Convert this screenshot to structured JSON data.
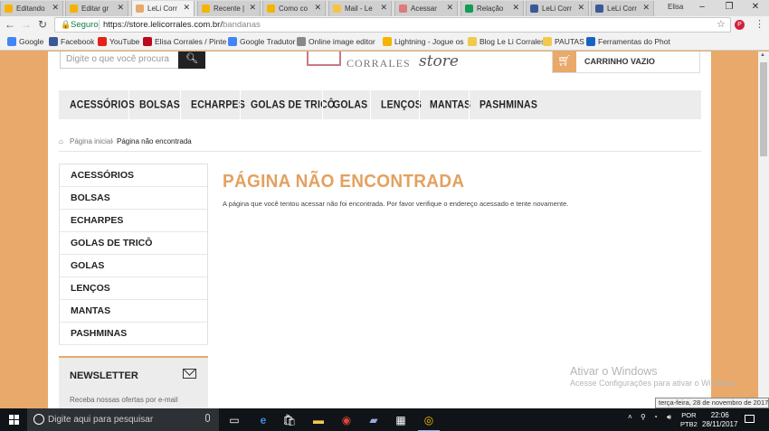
{
  "browser": {
    "tabs": [
      {
        "label": "Editando",
        "color": "#f4b400"
      },
      {
        "label": "Editar gr",
        "color": "#f4b400"
      },
      {
        "label": "LeLi Corr",
        "color": "#e8a96a",
        "active": true
      },
      {
        "label": "Recente |",
        "color": "#f4b400"
      },
      {
        "label": "Como co",
        "color": "#f4b400"
      },
      {
        "label": "Mail - Le",
        "color": "#f6c343"
      },
      {
        "label": "Acessar",
        "color": "#e07a7a"
      },
      {
        "label": "Relação",
        "color": "#0f9d58"
      },
      {
        "label": "LeLi Corr",
        "color": "#3b5998"
      },
      {
        "label": "LeLi Corr",
        "color": "#3b5998"
      }
    ],
    "user": "Elisa",
    "window_controls": [
      "–",
      "❐",
      "✕"
    ],
    "security_label": "Seguro",
    "url_host": "https://store.lelicorrales.com.br/",
    "url_path": "bandanas",
    "bookmarks": [
      {
        "label": "Google",
        "color": "#4285f4"
      },
      {
        "label": "Facebook",
        "color": "#3b5998"
      },
      {
        "label": "YouTube",
        "color": "#e62117"
      },
      {
        "label": "Elisa Corrales / Pinte",
        "color": "#bd081c"
      },
      {
        "label": "Google Tradutor",
        "color": "#4285f4"
      },
      {
        "label": "Online image editor",
        "color": "#888888"
      },
      {
        "label": "Lightning - Jogue os",
        "color": "#f4b400"
      },
      {
        "label": "Blog Le Li Corrales",
        "color": "#f2c94c"
      },
      {
        "label": "PAUTAS",
        "color": "#f2c94c"
      },
      {
        "label": "Ferramentas do Phot",
        "color": "#1565c0"
      }
    ]
  },
  "store": {
    "search_placeholder": "Digite o que você procura",
    "logo_text": "CORRALES",
    "logo_store": "store",
    "cart_label": "CARRINHO VAZIO",
    "nav": [
      "ACESSÓRIOS",
      "BOLSAS",
      "ECHARPES",
      "GOLAS DE TRICÔ",
      "GOLAS",
      "LENÇOS",
      "MANTAS",
      "PASHMINAS"
    ],
    "breadcrumb": {
      "home": "Página inicial",
      "current": "Página não encontrada"
    },
    "sidebar": [
      "ACESSÓRIOS",
      "BOLSAS",
      "ECHARPES",
      "GOLAS DE TRICÔ",
      "GOLAS",
      "LENÇOS",
      "MANTAS",
      "PASHMINAS"
    ],
    "newsletter_title": "NEWSLETTER",
    "newsletter_desc": "Receba nossas ofertas por e-mail",
    "error_title": "PÁGINA NÃO ENCONTRADA",
    "error_message": "A página que você tentou acessar não foi encontrada. Por favor verifique o endereço acessado e tente novamente.",
    "accent_color": "#e8a96a"
  },
  "windows": {
    "activation_title": "Ativar o Windows",
    "activation_sub": "Acesse Configurações para ativar o Windows.",
    "tooltip": "terça-feira, 28 de novembro de 2017",
    "search_placeholder": "Digite aqui para pesquisar",
    "lang_1": "POR",
    "lang_2": "PTB2",
    "time": "22:06",
    "date": "28/11/2017"
  }
}
